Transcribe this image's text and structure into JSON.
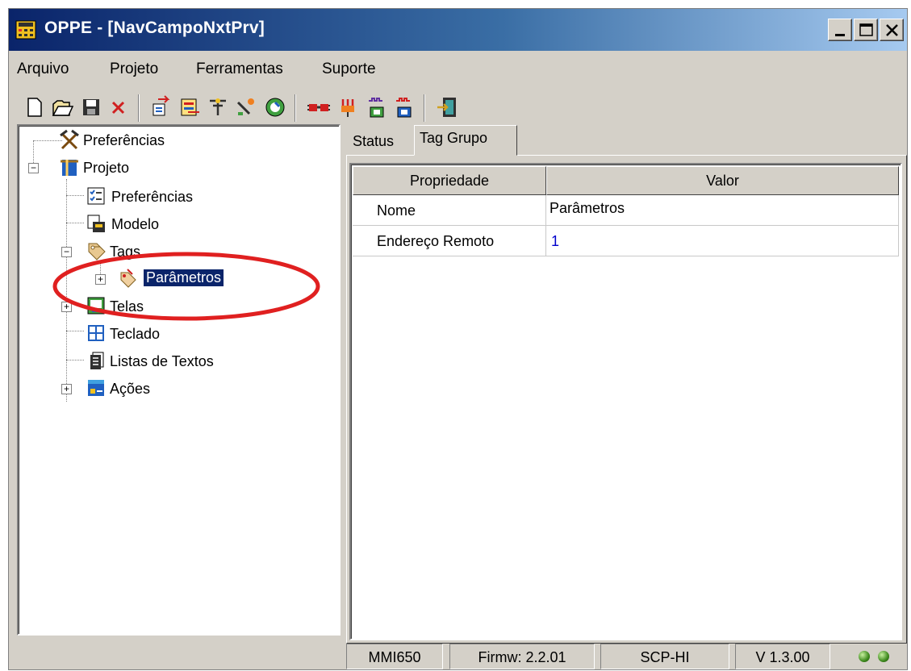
{
  "window": {
    "title": "OPPE - [NavCampoNxtPrv]",
    "controls": [
      "minimize-icon",
      "maximize-icon",
      "close-icon"
    ]
  },
  "menu": [
    "Arquivo",
    "Projeto",
    "Ferramentas",
    "Suporte"
  ],
  "toolbar": {
    "buttons": [
      "new-icon",
      "open-icon",
      "save-icon",
      "delete-icon",
      "import-icon",
      "export-icon",
      "tools-icon",
      "config-icon",
      "refresh-icon",
      "connect-icon",
      "plug-icon",
      "download-icon",
      "upload-icon",
      "exit-icon"
    ]
  },
  "tree": {
    "root_prefs": "Preferências",
    "project": "Projeto",
    "project_prefs": "Preferências",
    "model": "Modelo",
    "tags": "Tags",
    "parametros": "Parâmetros",
    "telas": "Telas",
    "teclado": "Teclado",
    "listas": "Listas de Textos",
    "acoes": "Ações"
  },
  "tabs": {
    "status": "Status",
    "tag_grupo": "Tag Grupo",
    "active": "Tag Grupo"
  },
  "grid": {
    "headers": [
      "Propriedade",
      "Valor"
    ],
    "rows": [
      {
        "prop": "Nome",
        "value": "Parâmetros"
      },
      {
        "prop": "Endereço Remoto",
        "value": "1"
      }
    ]
  },
  "statusbar": {
    "model": "MMI650",
    "firmware": "Firmw: 2.2.01",
    "protocol": "SCP-HI",
    "version": "V 1.3.00"
  },
  "colors": {
    "title_bar": "#0a246a",
    "selection": "#0a246a",
    "highlight_ellipse": "#e02020",
    "link_value": "#0000cc",
    "led": "#3e8a1e"
  }
}
